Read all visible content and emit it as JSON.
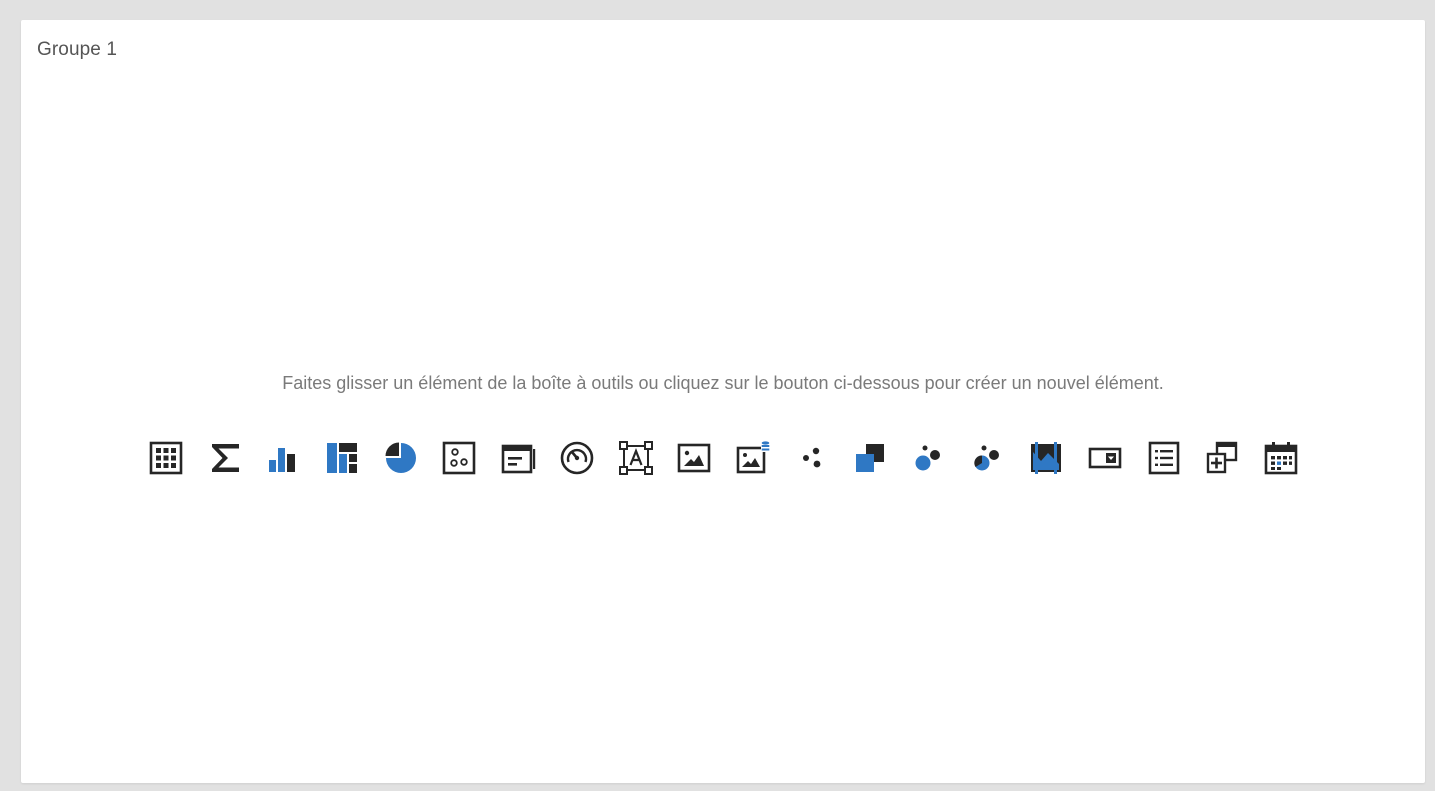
{
  "group": {
    "title": "Groupe 1"
  },
  "empty_state": {
    "hint": "Faites glisser un élément de la boîte à outils ou cliquez sur le bouton ci-dessous pour créer un nouvel élément."
  },
  "toolbox": {
    "items": [
      {
        "name": "grid-icon"
      },
      {
        "name": "sum-icon"
      },
      {
        "name": "bar-chart-icon"
      },
      {
        "name": "treemap-icon"
      },
      {
        "name": "pie-chart-icon"
      },
      {
        "name": "scatter-card-icon"
      },
      {
        "name": "card-icon"
      },
      {
        "name": "gauge-icon"
      },
      {
        "name": "text-box-icon"
      },
      {
        "name": "image-icon"
      },
      {
        "name": "bound-image-icon"
      },
      {
        "name": "scatter-icon"
      },
      {
        "name": "stacked-squares-icon"
      },
      {
        "name": "bubble-map-icon"
      },
      {
        "name": "pie-map-icon"
      },
      {
        "name": "range-filter-icon"
      },
      {
        "name": "combo-box-icon"
      },
      {
        "name": "list-box-icon"
      },
      {
        "name": "tree-view-icon"
      },
      {
        "name": "date-filter-icon"
      }
    ]
  },
  "colors": {
    "accent": "#2f78c4",
    "icon": "#262626",
    "hint_text": "#7a7a7a",
    "title_text": "#555555",
    "background": "#e1e1e1",
    "panel": "#ffffff"
  }
}
